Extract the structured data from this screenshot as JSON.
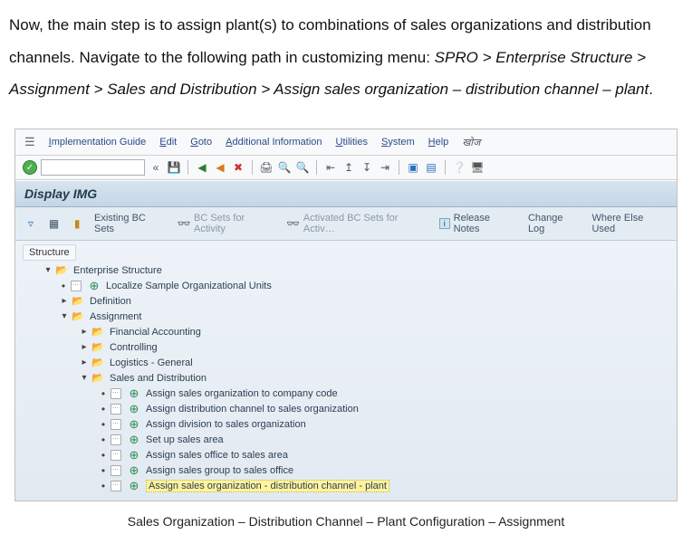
{
  "intro": {
    "text1": "Now, the main step is to assign plant(s) to combinations of sales organizations and distribution channels. Navigate to the following path in customizing menu: ",
    "path": "SPRO > Enterprise Structure > Assignment > Sales and Distribution > Assign sales organization – distribution channel – plant",
    "period": "."
  },
  "menubar": {
    "items": [
      "Implementation Guide",
      "Edit",
      "Goto",
      "Additional Information",
      "Utilities",
      "System",
      "Help"
    ],
    "extra": "खोज"
  },
  "toolbar": {
    "ok": "✓",
    "cmd_value": "",
    "back": "«"
  },
  "title": "Display IMG",
  "subtoolbar": {
    "existing": "Existing BC Sets",
    "activity": "BC Sets for Activity",
    "activated": "Activated BC Sets for Activ…",
    "release": "Release Notes",
    "changelog": "Change Log",
    "whereused": "Where Else Used",
    "info": "i"
  },
  "tree": {
    "structure_label": "Structure",
    "root": "Enterprise Structure",
    "nodes": {
      "localize": "Localize Sample Organizational Units",
      "definition": "Definition",
      "assignment": "Assignment",
      "fa": "Financial Accounting",
      "co": "Controlling",
      "lg": "Logistics - General",
      "sd": "Sales and Distribution",
      "leaves": [
        "Assign sales organization to company code",
        "Assign distribution channel to sales organization",
        "Assign division to sales organization",
        "Set up sales area",
        "Assign sales office to sales area",
        "Assign sales group to sales office",
        "Assign sales organization - distribution channel - plant"
      ]
    }
  },
  "caption": "Sales Organization – Distribution Channel – Plant Configuration – Assignment"
}
